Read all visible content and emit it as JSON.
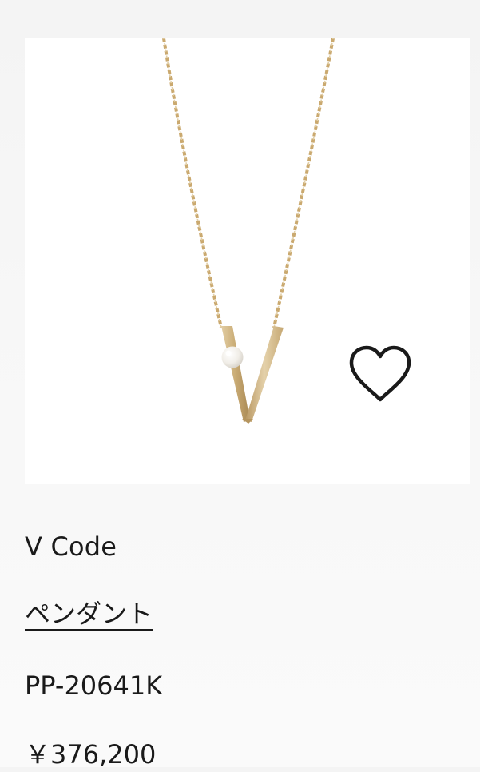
{
  "product": {
    "name": "V Code",
    "category_link": "ペンダント",
    "code": "PP-20641K",
    "price": "￥376,200",
    "image": "gold-v-pendant-necklace-with-pearl",
    "favorite_icon": "heart-outline-icon"
  },
  "colors": {
    "gold": "#c9ab74",
    "pearl": "#f3f0ea",
    "text": "#1a1a1a"
  }
}
